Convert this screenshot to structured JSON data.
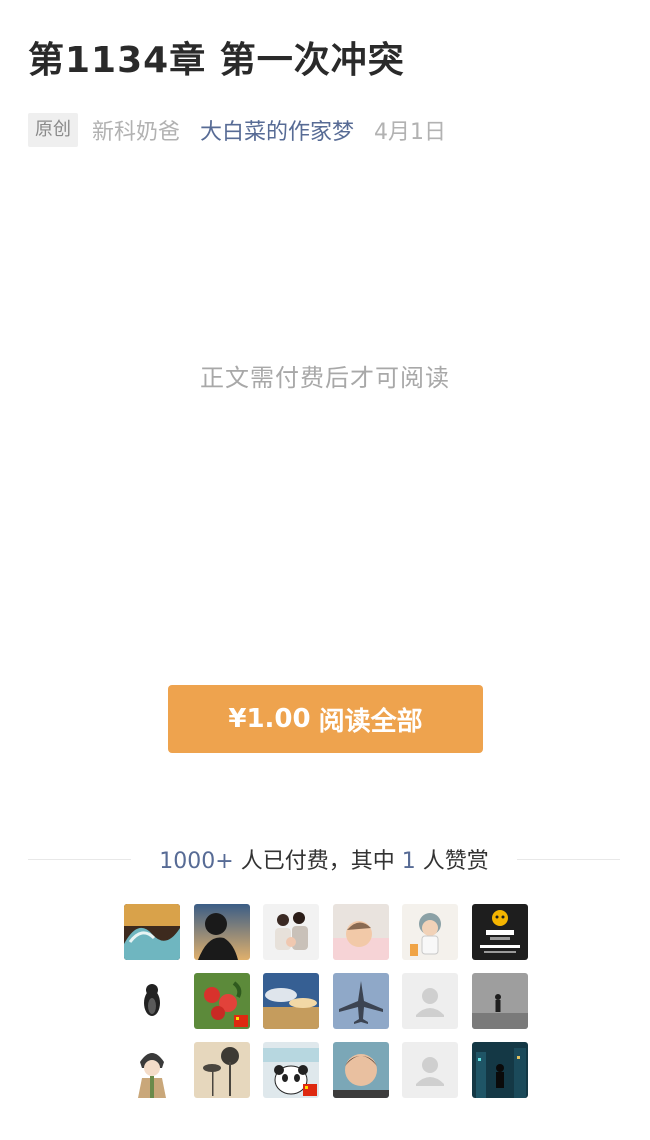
{
  "article": {
    "title": "第1134章 第一次冲突",
    "badge": "原创",
    "author": "新科奶爸",
    "account": "大白菜的作家梦",
    "date": "4月1日"
  },
  "paywall": {
    "notice": "正文需付费后才可阅读",
    "price": "¥1.00",
    "action": "阅读全部"
  },
  "stats": {
    "paid_count": "1000+",
    "paid_text": "人已付费，其中",
    "reward_count": "1",
    "reward_text": "人赞赏"
  },
  "avatars": [
    {
      "name": "avatar-wave-art",
      "icon": "wave-painting"
    },
    {
      "name": "avatar-silhouette-sunset",
      "icon": "silhouette"
    },
    {
      "name": "avatar-family-photo",
      "icon": "family"
    },
    {
      "name": "avatar-baby-sleeping",
      "icon": "baby"
    },
    {
      "name": "avatar-cartoon-child",
      "icon": "cartoon-child"
    },
    {
      "name": "avatar-suning-logo",
      "icon": "suning-logo"
    },
    {
      "name": "avatar-penguin-figure",
      "icon": "penguin"
    },
    {
      "name": "avatar-red-fruit-flag",
      "icon": "fruit",
      "flag": true
    },
    {
      "name": "avatar-cloudy-sky",
      "icon": "sky"
    },
    {
      "name": "avatar-jet-plane",
      "icon": "plane"
    },
    {
      "name": "avatar-default-placeholder",
      "icon": "default-user"
    },
    {
      "name": "avatar-dark-figure-gray",
      "icon": "figure-gray"
    },
    {
      "name": "avatar-anime-character",
      "icon": "anime"
    },
    {
      "name": "avatar-ink-lotus",
      "icon": "lotus"
    },
    {
      "name": "avatar-panda-flag",
      "icon": "panda",
      "flag": true
    },
    {
      "name": "avatar-kid-portrait",
      "icon": "kid"
    },
    {
      "name": "avatar-default-placeholder-2",
      "icon": "default-user"
    },
    {
      "name": "avatar-night-city-figure",
      "icon": "night-city"
    }
  ],
  "colors": {
    "link": "#576b95",
    "button": "#eea34e",
    "muted": "#b2b2b2"
  }
}
